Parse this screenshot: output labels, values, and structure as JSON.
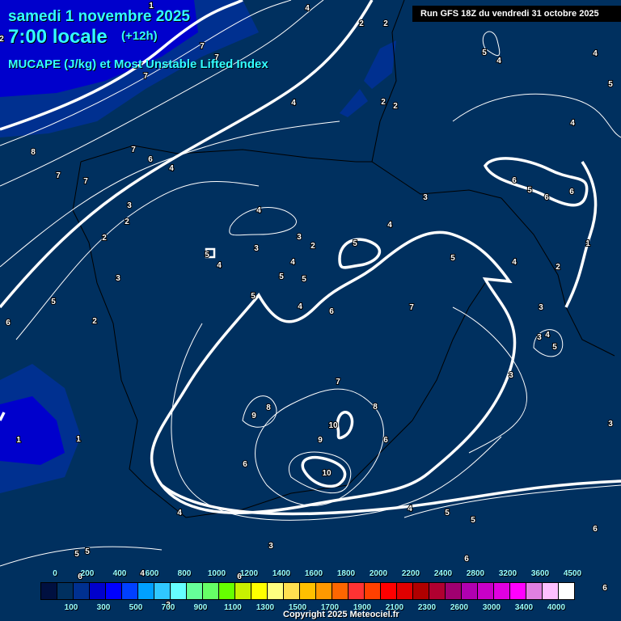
{
  "header": {
    "date": "samedi 1 novembre 2025",
    "time": "7:00 locale",
    "lead": "(+12h)",
    "parameter": "MUCAPE (J/kg) et Most Unstable Lifted Index",
    "run": "Run GFS 18Z du vendredi 31 octobre 2025"
  },
  "colorbar": {
    "values": [
      "0",
      "100",
      "200",
      "300",
      "400",
      "500",
      "600",
      "700",
      "800",
      "900",
      "1000",
      "1100",
      "1200",
      "1300",
      "1400",
      "1500",
      "1600",
      "1700",
      "1800",
      "1900",
      "2000",
      "2100",
      "2200",
      "2300",
      "2400",
      "2600",
      "2800",
      "3000",
      "3200",
      "3400",
      "3600",
      "4000",
      "4500"
    ],
    "colors": [
      "#001040",
      "#00305f",
      "#003090",
      "#0000cc",
      "#0000ff",
      "#0040ff",
      "#00a0ff",
      "#30c8ff",
      "#66ffff",
      "#66ff99",
      "#66ff66",
      "#66ff00",
      "#c8f000",
      "#ffff00",
      "#ffff80",
      "#ffe050",
      "#ffc000",
      "#ff9900",
      "#ff6600",
      "#ff3333",
      "#ff4000",
      "#ff0000",
      "#e00000",
      "#b00000",
      "#b00030",
      "#a00070",
      "#b000b0",
      "#c800c8",
      "#e000e0",
      "#ff00ff",
      "#e080e0",
      "#ffc0ff",
      "#ffffff"
    ]
  },
  "lifted_index_labels": [
    "1",
    "4",
    "2",
    "2",
    "4",
    "5",
    "4",
    "4",
    "5",
    "2",
    "7",
    "7",
    "7",
    "4",
    "2",
    "2",
    "4",
    "8",
    "7",
    "6",
    "4",
    "7",
    "7",
    "6",
    "5",
    "6",
    "6",
    "3",
    "3",
    "2",
    "4",
    "4",
    "2",
    "5",
    "3",
    "2",
    "3",
    "5",
    "4",
    "5",
    "4",
    "1",
    "2",
    "4",
    "3",
    "5",
    "5",
    "5",
    "4",
    "7",
    "6",
    "5",
    "3",
    "6",
    "2",
    "3",
    "4",
    "5",
    "7",
    "3",
    "8",
    "8",
    "9",
    "10",
    "9",
    "6",
    "1",
    "1",
    "3",
    "6",
    "10",
    "4",
    "5",
    "4",
    "5",
    "6",
    "3",
    "5",
    "5",
    "6",
    "6",
    "4",
    "6",
    "6",
    "3"
  ],
  "copyright": "Copyright 2025 Meteociel.fr"
}
